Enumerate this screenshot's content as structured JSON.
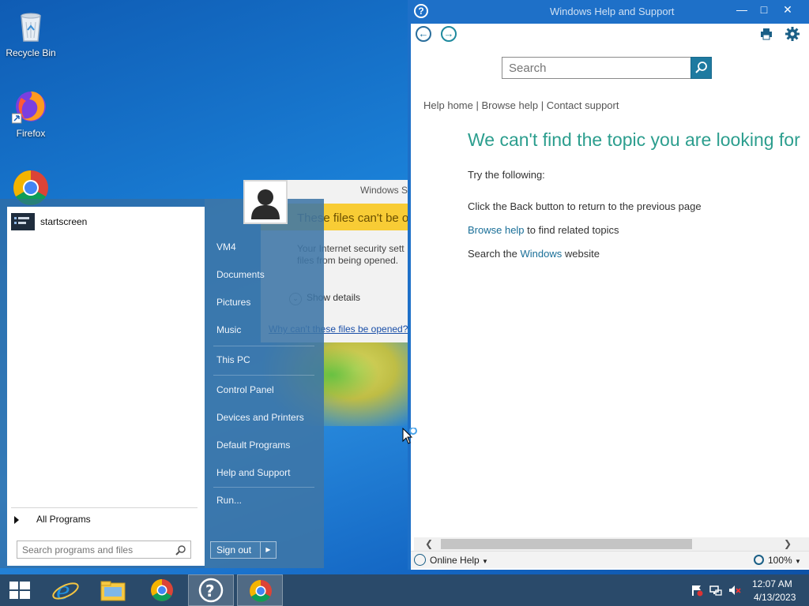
{
  "desktop": {
    "icons": [
      {
        "label": "Recycle Bin"
      },
      {
        "label": "Firefox"
      }
    ]
  },
  "help_window": {
    "title": "Windows Help and Support",
    "search": {
      "placeholder": "Search"
    },
    "links": {
      "home": "Help home",
      "sep1": "|",
      "browse": "Browse help",
      "sep2": "|",
      "contact": "Contact support"
    },
    "heading": "We can't find the topic you are looking for",
    "try_label": "Try the following:",
    "line1": "Click the Back button to return to the previous page",
    "line2_link": "Browse help",
    "line2_rest": "to find related topics",
    "line3_pre": "Search the",
    "line3_link": "Windows",
    "line3_post": "website",
    "status": {
      "online_help": "Online Help",
      "zoom": "100%"
    }
  },
  "dialog": {
    "title": "Windows S",
    "heading": "These files can't be o",
    "body_line1": "Your Internet security sett",
    "body_line2": "files from being opened.",
    "details": "Show details",
    "link": "Why can't these files be opened?"
  },
  "start_menu": {
    "pinned": [
      {
        "label": "startscreen"
      }
    ],
    "right_items": [
      {
        "label": "VM4"
      },
      {
        "label": "Documents"
      },
      {
        "label": "Pictures"
      },
      {
        "label": "Music"
      },
      {
        "label": "This PC"
      },
      {
        "label": "Control Panel"
      },
      {
        "label": "Devices and Printers"
      },
      {
        "label": "Default Programs"
      },
      {
        "label": "Help and Support"
      },
      {
        "label": "Run..."
      }
    ],
    "all_programs": "All Programs",
    "search_placeholder": "Search programs and files",
    "sign_out": "Sign out"
  },
  "taskbar": {
    "clock": {
      "time": "12:07 AM",
      "date": "4/13/2023"
    }
  }
}
